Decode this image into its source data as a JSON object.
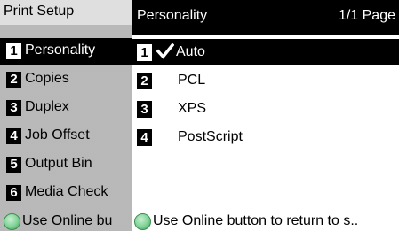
{
  "left_panel": {
    "title": "Print Setup",
    "items": [
      {
        "num": "1",
        "label": "Personality",
        "selected": true
      },
      {
        "num": "2",
        "label": "Copies"
      },
      {
        "num": "3",
        "label": "Duplex"
      },
      {
        "num": "4",
        "label": "Job Offset"
      },
      {
        "num": "5",
        "label": "Output Bin"
      },
      {
        "num": "6",
        "label": "Media Check"
      }
    ],
    "footer_text": "Use Online bu"
  },
  "right_panel": {
    "title": "Personality",
    "page_indicator": "1/1 Page",
    "options": [
      {
        "num": "1",
        "label": "Auto",
        "selected": true,
        "checked": true
      },
      {
        "num": "2",
        "label": "PCL"
      },
      {
        "num": "3",
        "label": "XPS"
      },
      {
        "num": "4",
        "label": "PostScript"
      }
    ],
    "footer_text": "Use Online button to return to s.."
  },
  "icons": {
    "check": "check-mark-icon",
    "online_button": "online-button-icon"
  },
  "colors": {
    "header_bg": "#000000",
    "menu_bg": "#c4c4c4",
    "online_button": "#7fd196"
  }
}
